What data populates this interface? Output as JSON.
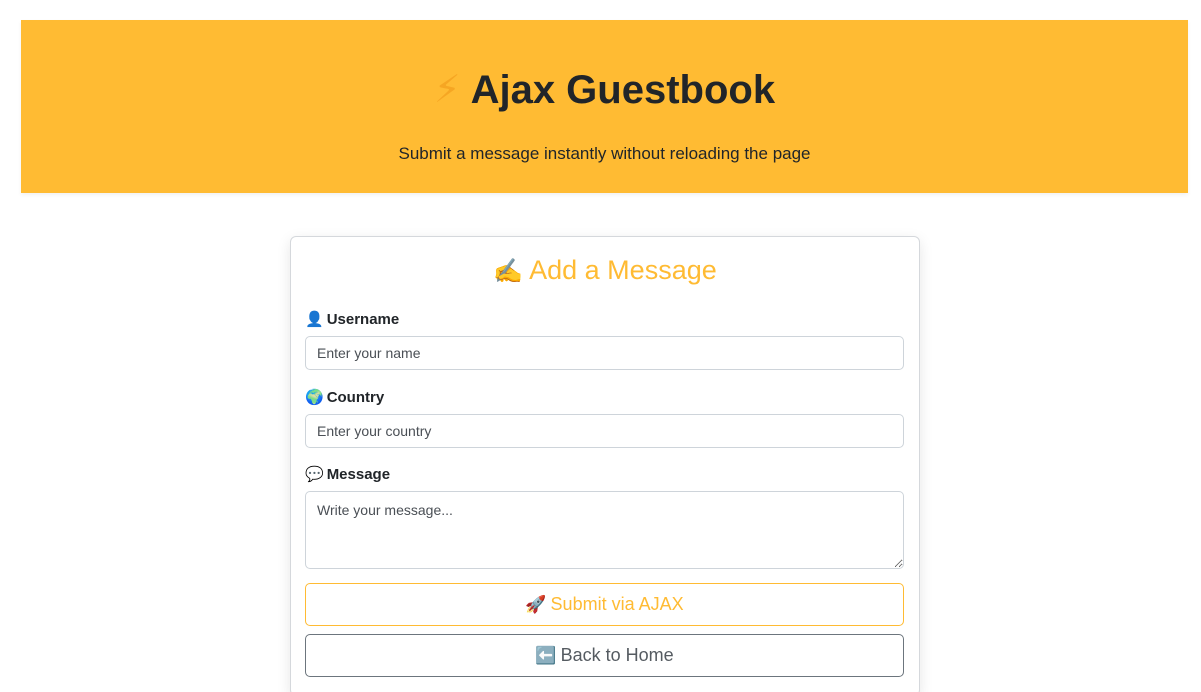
{
  "header": {
    "bolt_icon": "⚡",
    "title": "Ajax Guestbook",
    "subtitle": "Submit a message instantly without reloading the page"
  },
  "form": {
    "title_icon": "✍️",
    "title": "Add a Message",
    "username": {
      "icon": "👤",
      "label": "Username",
      "placeholder": "Enter your name",
      "value": ""
    },
    "country": {
      "icon": "🌍",
      "label": "Country",
      "placeholder": "Enter your country",
      "value": ""
    },
    "message": {
      "icon": "💬",
      "label": "Message",
      "placeholder": "Write your message...",
      "value": ""
    },
    "submit_icon": "🚀",
    "submit_label": "Submit via AJAX",
    "home_icon": "⬅️",
    "home_label": "Back to Home"
  },
  "colors": {
    "accent": "#ffbb33",
    "text": "#212529",
    "secondary": "#6c757d"
  }
}
